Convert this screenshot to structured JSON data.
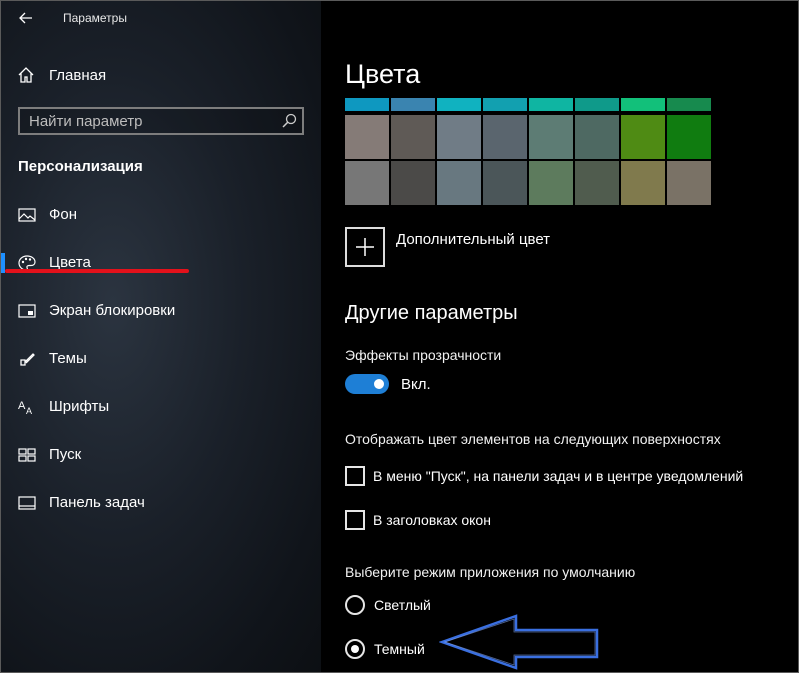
{
  "window": {
    "title": "Параметры",
    "back_icon": "back-arrow-icon"
  },
  "sidebar": {
    "home_label": "Главная",
    "search": {
      "placeholder": "Найти параметр",
      "value": ""
    },
    "section_title": "Персонализация",
    "items": [
      {
        "label": "Фон",
        "icon": "picture-icon",
        "active": false
      },
      {
        "label": "Цвета",
        "icon": "palette-icon",
        "active": true
      },
      {
        "label": "Экран блокировки",
        "icon": "lock-screen-icon",
        "active": false
      },
      {
        "label": "Темы",
        "icon": "themes-icon",
        "active": false
      },
      {
        "label": "Шрифты",
        "icon": "fonts-icon",
        "active": false
      },
      {
        "label": "Пуск",
        "icon": "start-icon",
        "active": false
      },
      {
        "label": "Панель задач",
        "icon": "taskbar-icon",
        "active": false
      }
    ]
  },
  "main": {
    "title": "Цвета",
    "swatches": [
      [
        "#0e98c0",
        "#3a84b0",
        "#10b2c0",
        "#12a0b0",
        "#0fb5a2",
        "#0f9a8a",
        "#12c07a",
        "#178a4e"
      ],
      [
        "#857b77",
        "#5f5a56",
        "#707c86",
        "#5a656e",
        "#5d7c74",
        "#4e6962",
        "#4f8b14",
        "#107c10"
      ],
      [
        "#777",
        "#4b4a48",
        "#687880",
        "#4b5659",
        "#5d7b5d",
        "#505c4e",
        "#807a4d",
        "#7a7266"
      ]
    ],
    "custom_color_label": "Дополнительный цвет",
    "other_params_title": "Другие параметры",
    "transparency": {
      "label": "Эффекты прозрачности",
      "state_label": "Вкл.",
      "on": true
    },
    "surfaces_label": "Отображать цвет элементов на следующих поверхностях",
    "checkboxes": [
      {
        "label": "В меню \"Пуск\", на панели задач и в центре уведомлений",
        "checked": false
      },
      {
        "label": "В заголовках окон",
        "checked": false
      }
    ],
    "app_mode_label": "Выберите режим приложения по умолчанию",
    "radios": [
      {
        "label": "Светлый",
        "selected": false
      },
      {
        "label": "Темный",
        "selected": true
      }
    ]
  },
  "annotations": {
    "underline_color": "#e3111b",
    "arrow_color": "#3a6fe0"
  }
}
